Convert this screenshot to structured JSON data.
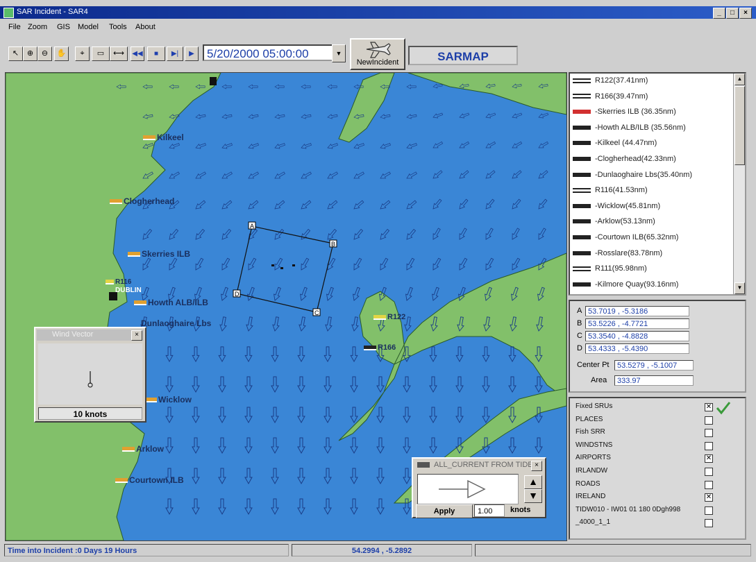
{
  "window": {
    "title": "SAR Incident - SAR4",
    "controls": [
      "_",
      "□",
      "×"
    ]
  },
  "menu": [
    "File",
    "Zoom",
    "GIS",
    "Model",
    "Tools",
    "About"
  ],
  "toolbar": {
    "tools": [
      {
        "name": "pointer-tool",
        "glyph": "↖"
      },
      {
        "name": "zoom-in-tool",
        "glyph": "⊕"
      },
      {
        "name": "zoom-out-tool",
        "glyph": "⊖"
      },
      {
        "name": "pan-tool",
        "glyph": "✋"
      },
      {
        "name": "identify-tool",
        "glyph": "⌖"
      },
      {
        "name": "rectangle-tool",
        "glyph": "▭"
      },
      {
        "name": "measure-tool",
        "glyph": "⟷"
      }
    ],
    "playback": [
      {
        "name": "rewind-button",
        "glyph": "◀◀"
      },
      {
        "name": "stop-button",
        "glyph": "■"
      },
      {
        "name": "step-button",
        "glyph": "▶|"
      },
      {
        "name": "play-button",
        "glyph": "▶"
      }
    ],
    "datetime": "5/20/2000 05:00:00",
    "new_incident_label": "NewIncident",
    "brand": "SARMAP"
  },
  "map": {
    "places": [
      {
        "label": "Kilkeel"
      },
      {
        "label": "Clogherhead"
      },
      {
        "label": "Skerries ILB"
      },
      {
        "label": "R116"
      },
      {
        "label": "DUBLIN"
      },
      {
        "label": "Howth ALB/ILB"
      },
      {
        "label": "Dunlaoghaire Lbs"
      },
      {
        "label": "Wicklow"
      },
      {
        "label": "Arklow"
      },
      {
        "label": "Courtown ILB"
      },
      {
        "label": "R122"
      },
      {
        "label": "R166"
      }
    ],
    "search_area_points": [
      "A",
      "B",
      "C",
      "D"
    ]
  },
  "resources": [
    {
      "label": "R122(37.41nm)",
      "icon": "helicopter-icon"
    },
    {
      "label": "R166(39.47nm)",
      "icon": "helicopter-icon"
    },
    {
      "label": "-Skerries ILB (36.35nm)",
      "icon": "lifeboat-icon-red"
    },
    {
      "label": "-Howth ALB/ILB (35.56nm)",
      "icon": "lifeboat-icon"
    },
    {
      "label": "-Kilkeel (44.47nm)",
      "icon": "lifeboat-icon"
    },
    {
      "label": "-Clogherhead(42.33nm)",
      "icon": "lifeboat-icon"
    },
    {
      "label": "-Dunlaoghaire Lbs(35.40nm)",
      "icon": "lifeboat-icon"
    },
    {
      "label": "R116(41.53nm)",
      "icon": "helicopter-icon"
    },
    {
      "label": "-Wicklow(45.81nm)",
      "icon": "lifeboat-icon"
    },
    {
      "label": "-Arklow(53.13nm)",
      "icon": "lifeboat-icon"
    },
    {
      "label": "-Courtown ILB(65.32nm)",
      "icon": "lifeboat-icon"
    },
    {
      "label": "-Rosslare(83.78nm)",
      "icon": "lifeboat-icon"
    },
    {
      "label": "R111(95.98nm)",
      "icon": "helicopter-icon"
    },
    {
      "label": "-Kilmore Quay(93.16nm)",
      "icon": "lifeboat-icon"
    }
  ],
  "search_area": {
    "corners": [
      {
        "label": "A",
        "value": "53.7019 , -5.3186"
      },
      {
        "label": "B",
        "value": "53.5226 , -4.7721"
      },
      {
        "label": "C",
        "value": "53.3540 , -4.8828"
      },
      {
        "label": "D",
        "value": "53.4333 , -5.4390"
      }
    ],
    "center_label": "Center Pt",
    "center_value": "53.5279 , -5.1007",
    "area_label": "Area",
    "area_value": "333.97"
  },
  "layers": [
    {
      "label": "Fixed SRUs",
      "checked": true
    },
    {
      "label": "PLACES",
      "checked": false
    },
    {
      "label": "Fish SRR",
      "checked": false
    },
    {
      "label": "WINDSTNS",
      "checked": false
    },
    {
      "label": "AIRPORTS",
      "checked": true
    },
    {
      "label": "IRLANDW",
      "checked": false
    },
    {
      "label": "ROADS",
      "checked": false
    },
    {
      "label": "IRELAND",
      "checked": true
    },
    {
      "label": "TIDW010 - IW01 01 180 0Dgh998",
      "checked": false
    },
    {
      "label": "_4000_1_1",
      "checked": false
    }
  ],
  "wind_vector": {
    "title": "Wind Vector",
    "speed": "10 knots"
  },
  "current_panel": {
    "title": "ALL_CURRENT FROM TIDE",
    "apply_label": "Apply",
    "speed_value": "1.00",
    "unit_label": "knots"
  },
  "status": {
    "time_into": "Time into Incident :0 Days  19 Hours",
    "cursor_coords": "54.2994 , -5.2892"
  },
  "colors": {
    "sea": "#3a86d6",
    "land": "#82c06a",
    "accent": "#1d3fa8"
  }
}
